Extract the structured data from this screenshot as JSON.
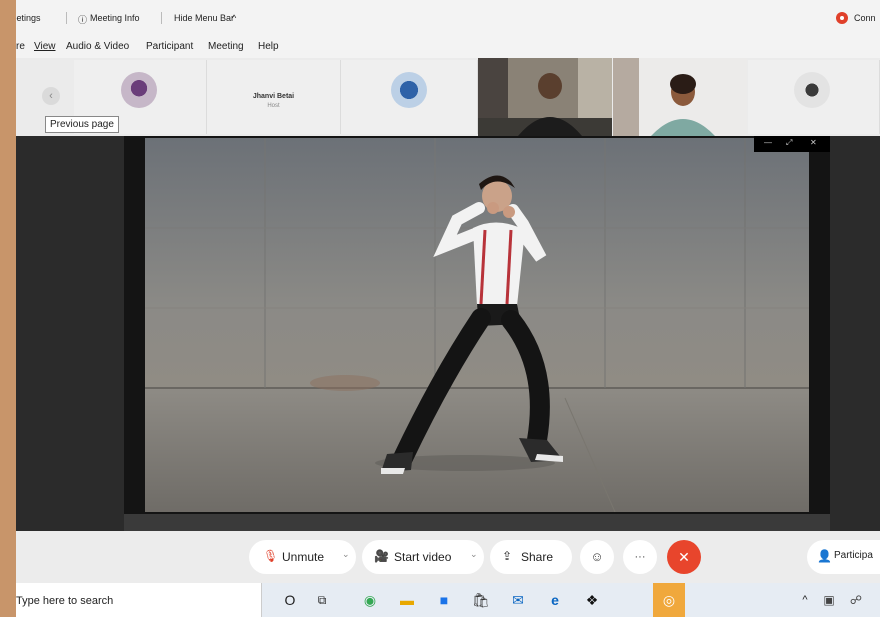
{
  "topbar": {
    "meetings": "Meetings",
    "meeting_info": "Meeting Info",
    "hide_menu_bar": "Hide Menu Bar",
    "connection": "Conn"
  },
  "menu": {
    "items": [
      "re",
      "View",
      "Audio & Video",
      "Participant",
      "Meeting",
      "Help"
    ]
  },
  "participants": {
    "host_name": "Jhanvi Betai",
    "host_role": "Host"
  },
  "tooltip": {
    "text": "Previous page"
  },
  "controls": {
    "unmute": "Unmute",
    "start_video": "Start video",
    "share": "Share",
    "more": "···",
    "participants": "Participa"
  },
  "taskbar": {
    "search_placeholder": "Type here to search"
  },
  "colors": {
    "end_button": "#e8452c",
    "connection_dot": "#e0402a",
    "page_border": "#c8956a"
  }
}
